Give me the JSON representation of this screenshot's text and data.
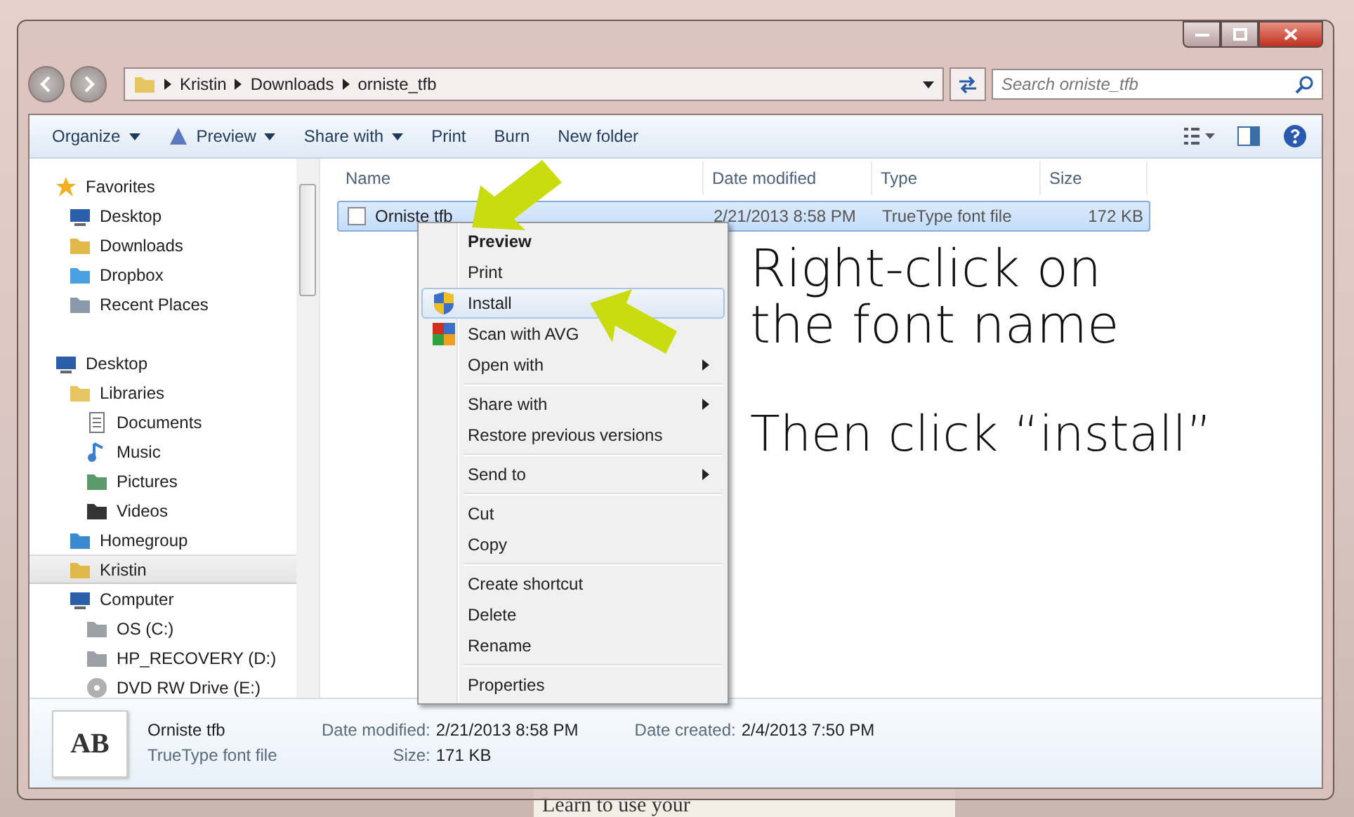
{
  "address": {
    "crumbs": [
      "Kristin",
      "Downloads",
      "orniste_tfb"
    ]
  },
  "search": {
    "placeholder": "Search orniste_tfb"
  },
  "toolbar": [
    {
      "label": "Organize",
      "dropdown": true,
      "kind": "plain"
    },
    {
      "label": "Preview",
      "dropdown": true,
      "kind": "preview"
    },
    {
      "label": "Share with",
      "dropdown": true,
      "kind": "plain"
    },
    {
      "label": "Print",
      "dropdown": false,
      "kind": "plain"
    },
    {
      "label": "Burn",
      "dropdown": false,
      "kind": "plain"
    },
    {
      "label": "New folder",
      "dropdown": false,
      "kind": "plain"
    }
  ],
  "sidebar": [
    {
      "label": "Favorites",
      "kind": "star",
      "selected": false,
      "children": [
        {
          "label": "Desktop",
          "kind": "monitor",
          "selected": false
        },
        {
          "label": "Downloads",
          "kind": "download",
          "selected": false
        },
        {
          "label": "Dropbox",
          "kind": "dropbox",
          "selected": false
        },
        {
          "label": "Recent Places",
          "kind": "recent",
          "selected": false
        }
      ]
    },
    {
      "label": "Desktop",
      "kind": "monitor",
      "selected": false,
      "children": [
        {
          "label": "Libraries",
          "kind": "folder",
          "selected": false,
          "children": [
            {
              "label": "Documents",
              "kind": "document",
              "selected": false
            },
            {
              "label": "Music",
              "kind": "music",
              "selected": false
            },
            {
              "label": "Pictures",
              "kind": "pictures",
              "selected": false
            },
            {
              "label": "Videos",
              "kind": "film",
              "selected": false
            }
          ]
        },
        {
          "label": "Homegroup",
          "kind": "homegroup",
          "selected": false
        },
        {
          "label": "Kristin",
          "kind": "user",
          "selected": true
        },
        {
          "label": "Computer",
          "kind": "computer",
          "selected": false,
          "children": [
            {
              "label": "OS (C:)",
              "kind": "drive",
              "selected": false
            },
            {
              "label": "HP_RECOVERY (D:)",
              "kind": "drive",
              "selected": false
            },
            {
              "label": "DVD RW Drive (E:)",
              "kind": "disc",
              "selected": false
            }
          ]
        }
      ]
    }
  ],
  "table": {
    "columns": [
      "Name",
      "Date modified",
      "Type",
      "Size"
    ],
    "rows": [
      {
        "name": "Orniste tfb",
        "date_modified": "2/21/2013 8:58 PM",
        "type": "TrueType font file",
        "size": "172 KB",
        "selected": true
      }
    ]
  },
  "context_menu": [
    {
      "kind": "item",
      "label": "Preview",
      "bold": true,
      "submenu": false,
      "selected": false
    },
    {
      "kind": "item",
      "label": "Print",
      "bold": false,
      "submenu": false,
      "selected": false
    },
    {
      "kind": "shield",
      "label": "Install",
      "bold": false,
      "submenu": false,
      "selected": true
    },
    {
      "kind": "scanner",
      "label": "Scan with AVG",
      "bold": false,
      "submenu": false,
      "selected": false
    },
    {
      "kind": "item",
      "label": "Open with",
      "bold": false,
      "submenu": true,
      "selected": false
    },
    {
      "kind": "separator"
    },
    {
      "kind": "item",
      "label": "Share with",
      "bold": false,
      "submenu": true,
      "selected": false
    },
    {
      "kind": "item",
      "label": "Restore previous versions",
      "bold": false,
      "submenu": false,
      "selected": false
    },
    {
      "kind": "separator"
    },
    {
      "kind": "item",
      "label": "Send to",
      "bold": false,
      "submenu": true,
      "selected": false
    },
    {
      "kind": "separator"
    },
    {
      "kind": "item",
      "label": "Cut",
      "bold": false,
      "submenu": false,
      "selected": false
    },
    {
      "kind": "item",
      "label": "Copy",
      "bold": false,
      "submenu": false,
      "selected": false
    },
    {
      "kind": "separator"
    },
    {
      "kind": "item",
      "label": "Create shortcut",
      "bold": false,
      "submenu": false,
      "selected": false
    },
    {
      "kind": "item",
      "label": "Delete",
      "bold": false,
      "submenu": false,
      "selected": false
    },
    {
      "kind": "item",
      "label": "Rename",
      "bold": false,
      "submenu": false,
      "selected": false
    },
    {
      "kind": "separator"
    },
    {
      "kind": "item",
      "label": "Properties",
      "bold": false,
      "submenu": false,
      "selected": false
    }
  ],
  "annotations": [
    "Right-click on the font name",
    "Then click “install”"
  ],
  "details": {
    "thumbnail": "AB",
    "name": "Orniste tfb",
    "type": "TrueType font file",
    "fields": [
      {
        "label": "Date modified:",
        "value": "2/21/2013 8:58 PM"
      },
      {
        "label": "Size:",
        "value": "171 KB"
      },
      {
        "label": "Date created:",
        "value": "2/4/2013 7:50 PM"
      }
    ]
  },
  "background": {
    "caption": "Learn to use your"
  }
}
